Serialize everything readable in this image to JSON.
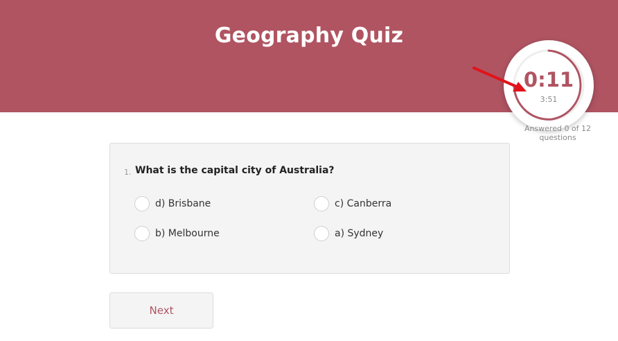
{
  "header": {
    "title": "Geography Quiz",
    "background_color": "#b05462"
  },
  "timer": {
    "elapsed": "0:11",
    "total": "3:51",
    "progress_fraction": 0.048,
    "ring_color": "#b05462"
  },
  "annotation": {
    "arrow_color": "#e0141a",
    "icon": "red-arrow-icon"
  },
  "progress": {
    "text": "Answered 0 of 12 questions"
  },
  "question": {
    "number": "1.",
    "text": "What is the capital city of Australia?",
    "options": [
      {
        "label": "d) Brisbane"
      },
      {
        "label": "c) Canberra"
      },
      {
        "label": "b) Melbourne"
      },
      {
        "label": "a) Sydney"
      }
    ]
  },
  "navigation": {
    "next_label": "Next"
  }
}
